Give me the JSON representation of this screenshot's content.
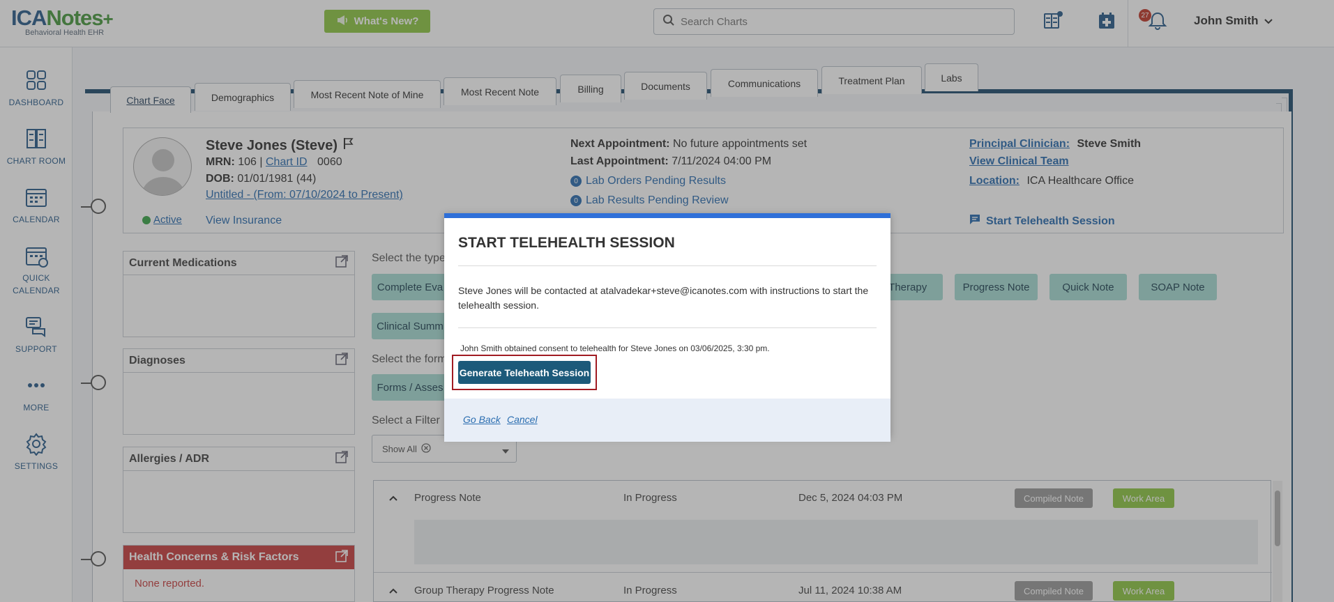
{
  "topbar": {
    "logo_main_a": "ICA",
    "logo_main_b": "Notes",
    "logo_plus": "+",
    "logo_sub": "Behavioral Health EHR",
    "whats_new": "What's New?",
    "search_placeholder": "Search Charts",
    "notification_count": "27",
    "user_name": "John Smith"
  },
  "sidebar": {
    "items": [
      {
        "label": "DASHBOARD",
        "icon": "dashboard-icon"
      },
      {
        "label": "CHART ROOM",
        "icon": "chart-room-icon"
      },
      {
        "label": "CALENDAR",
        "icon": "calendar-icon"
      },
      {
        "label": "QUICK\nCALENDAR",
        "label_a": "QUICK",
        "label_b": "CALENDAR",
        "icon": "quick-calendar-icon"
      },
      {
        "label": "SUPPORT",
        "icon": "support-icon"
      },
      {
        "label": "MORE",
        "icon": "more-icon"
      },
      {
        "label": "SETTINGS",
        "icon": "settings-icon"
      }
    ]
  },
  "tabs": [
    "Chart Face",
    "Demographics",
    "Most Recent Note of Mine",
    "Most Recent Note",
    "Billing",
    "Documents",
    "Communications",
    "Treatment Plan",
    "Labs"
  ],
  "patient": {
    "name": "Steve Jones (Steve)",
    "mrn_label": "MRN:",
    "mrn": "106",
    "sep": "|",
    "chart_id_label": "Chart ID",
    "chart_id": "0060",
    "dob_label": "DOB:",
    "dob": "01/01/1981 (44)",
    "episode": "Untitled - (From: 07/10/2024 to Present)",
    "status": "Active",
    "insurance": "View Insurance",
    "next_appt_label": "Next Appointment:",
    "next_appt": "No future appointments set",
    "last_appt_label": "Last Appointment:",
    "last_appt": "7/11/2024 04:00 PM",
    "lab_orders_count": "0",
    "lab_orders": "Lab Orders Pending Results",
    "lab_results_count": "0",
    "lab_results": "Lab Results Pending Review",
    "clinician_label": "Principal Clinician:",
    "clinician": "Steve Smith",
    "clinical_team": "View Clinical Team",
    "location_label": "Location:",
    "location": "ICA Healthcare Office",
    "telehealth_link": "Start Telehealth Session"
  },
  "widgets": {
    "medications": "Current Medications",
    "diagnoses": "Diagnoses",
    "allergies": "Allergies / ADR",
    "health_concerns": "Health Concerns & Risk Factors",
    "health_concerns_body": "None reported."
  },
  "center": {
    "select_type": "Select the type",
    "select_form": "Select the form",
    "select_filter": "Select a Filter",
    "pills_row1": [
      "Complete Eva",
      "y Therapy",
      "Progress Note",
      "Quick Note",
      "SOAP Note"
    ],
    "pill_row2": "Clinical Summ",
    "forms_pill": "Forms / Asses",
    "filter_value": "Show All",
    "notes": [
      {
        "title": "Progress Note",
        "status": "In Progress",
        "date": "Dec 5, 2024 04:03 PM",
        "compiled": "Compiled Note",
        "work": "Work Area"
      },
      {
        "title": "Group Therapy Progress Note",
        "status": "In Progress",
        "date": "Jul 11, 2024 10:38 AM",
        "compiled": "Compiled Note",
        "work": "Work Area"
      }
    ]
  },
  "modal": {
    "title": "START TELEHEALTH SESSION",
    "message": "Steve Jones will be contacted at atalvadekar+steve@icanotes.com with instructions to start the telehealth session.",
    "consent": "John Smith obtained consent to telehealth for Steve Jones on 03/06/2025, 3:30 pm.",
    "generate_button": "Generate Teleheath Session",
    "go_back": "Go Back",
    "cancel": "Cancel"
  },
  "colors": {
    "brand_blue": "#2a5d8c",
    "accent_green": "#8fc744",
    "modal_top": "#2e6fd8",
    "primary_button": "#1c5a7a",
    "highlight": "#a11b22",
    "pill": "#a6dcd4",
    "compiled": "#9a9a9a",
    "work_area": "#8fc744",
    "health_red": "#c94040"
  }
}
